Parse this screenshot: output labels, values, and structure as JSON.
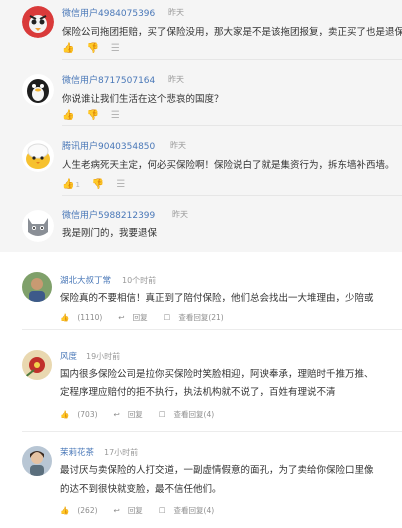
{
  "top_comments": [
    {
      "username": "微信用户4984075396",
      "time": "昨天",
      "text": "保险公司拖团拒赔，买了保险没用，那大家是不是该拖团报复，卖正买了也是退保",
      "likes": "",
      "avatar_icon": "angry-red-bird-avatar"
    },
    {
      "username": "微信用户8717507164",
      "time": "昨天",
      "text": "你说谁让我们生活在这个悲哀的国度？",
      "likes": "",
      "avatar_icon": "black-penguin-avatar"
    },
    {
      "username": "腾讯用户9040354850",
      "time": "昨天",
      "text": "人生老病死天主定，何必买保险啊！保险说白了就是集资行为，拆东墙补西墙。",
      "likes": "1",
      "avatar_icon": "egg-chick-avatar"
    },
    {
      "username": "微信用户5988212399",
      "time": "昨天",
      "text": "我是刚门的，我要退保",
      "likes": "",
      "avatar_icon": "gray-cat-avatar"
    }
  ],
  "bottom_comments": [
    {
      "username": "湖北大叔丁常",
      "time": "10个时前",
      "lines": [
        "保险真的不要相信！真正到了陪付保险，他们总会找出一大堆理由，少陪或"
      ],
      "likes": "(1110)",
      "reply_label": "回复",
      "view_replies_label": "查看回复(21)",
      "avatar_icon": "man-photo-avatar"
    },
    {
      "username": "风度",
      "time": "19小时前",
      "lines": [
        "国内很多保险公司是拉你买保险时笑脸相迎，阿谀奉承，理赔时千推万推、",
        "定程序理应赔付的拒不执行，执法机构就不说了，百姓有理说不清"
      ],
      "likes": "(703)",
      "reply_label": "回复",
      "view_replies_label": "查看回复(4)",
      "avatar_icon": "red-flower-avatar"
    },
    {
      "username": "茉莉花茶",
      "time": "17小时前",
      "lines": [
        "最讨厌与卖保险的人打交道，一副虚情假意的面孔，为了卖给你保险口里像",
        "的达不到很快就变脸，最不信任他们。"
      ],
      "likes": "(262)",
      "reply_label": "回复",
      "view_replies_label": "查看回复(4)",
      "avatar_icon": "woman-photo-avatar"
    }
  ]
}
